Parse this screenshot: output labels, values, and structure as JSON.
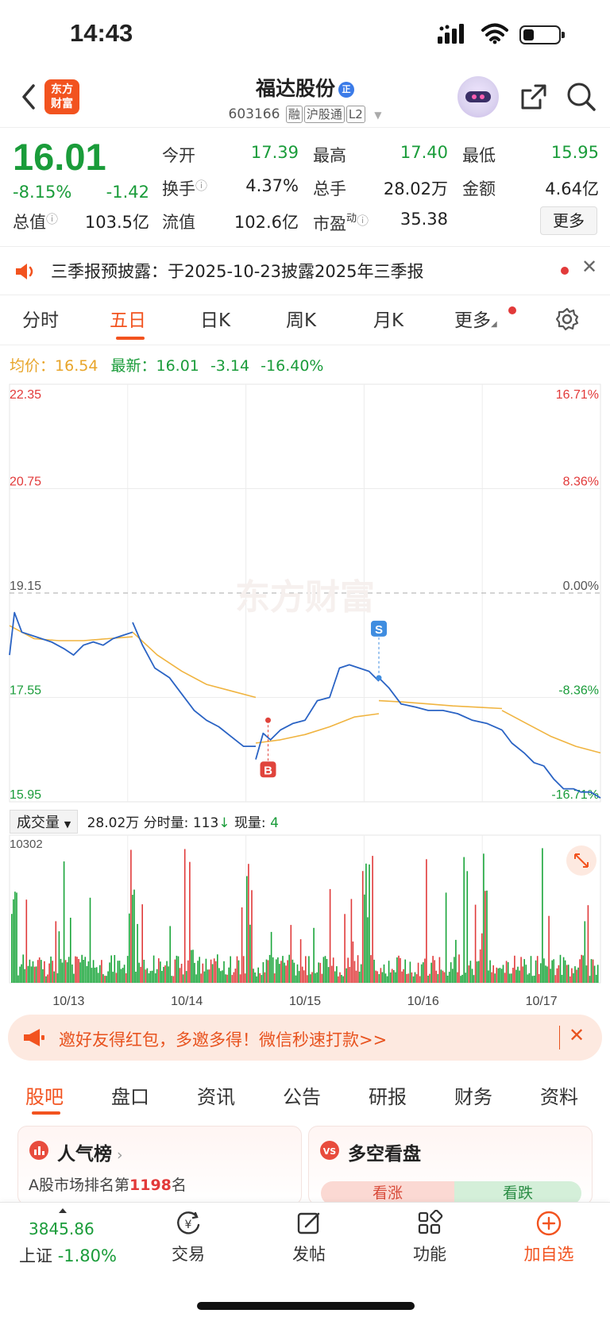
{
  "status_bar": {
    "time": "14:43"
  },
  "header": {
    "logo_line1": "东方",
    "logo_line2": "财富",
    "title": "福达股份",
    "badge": "正",
    "code": "603166",
    "tags": [
      "融",
      "沪股通",
      "L2"
    ]
  },
  "quote": {
    "price": "16.01",
    "change_pct": "-8.15%",
    "change": "-1.42",
    "fields": [
      {
        "label": "今开",
        "value": "17.39",
        "color": "#1a9c3a"
      },
      {
        "label": "最高",
        "value": "17.40",
        "color": "#1a9c3a"
      },
      {
        "label": "最低",
        "value": "15.95",
        "color": "#1a9c3a"
      },
      {
        "label": "换手",
        "value": "4.37%",
        "color": "#222222"
      },
      {
        "label": "总手",
        "value": "28.02万",
        "color": "#222222"
      },
      {
        "label": "金额",
        "value": "4.64亿",
        "color": "#222222"
      },
      {
        "label": "总值",
        "value": "103.5亿",
        "color": "#222222"
      },
      {
        "label": "流值",
        "value": "102.6亿",
        "color": "#222222"
      },
      {
        "label": "市盈",
        "value": "35.38",
        "color": "#222222"
      }
    ],
    "pe_sup": "动",
    "more_button": "更多"
  },
  "notice": {
    "text": "三季报预披露：于2025-10-23披露2025年三季报"
  },
  "chart_tabs": [
    "分时",
    "五日",
    "日K",
    "周K",
    "月K",
    "更多"
  ],
  "chart_info": {
    "avg_label": "均价：",
    "avg_value": "16.54",
    "latest_label": "最新：",
    "latest_value": "16.01",
    "latest_change": "-3.14",
    "latest_pct": "-16.40%"
  },
  "watermark": "东方财富",
  "chart_data": {
    "type": "line",
    "title": "",
    "x": [
      "10/13",
      "10/14",
      "10/15",
      "10/16",
      "10/17"
    ],
    "y_left_ticks": [
      "22.35",
      "20.75",
      "19.15",
      "17.55",
      "15.95"
    ],
    "y_right_ticks": [
      "16.71%",
      "8.36%",
      "0.00%",
      "-8.36%",
      "-16.71%"
    ],
    "ylim": [
      15.95,
      22.35
    ],
    "reference": 19.15,
    "series": [],
    "price_path": [
      [
        0.0,
        18.2
      ],
      [
        0.2,
        18.85
      ],
      [
        0.5,
        18.55
      ],
      [
        0.9,
        18.5
      ],
      [
        1.3,
        18.45
      ],
      [
        1.7,
        18.4
      ],
      [
        2.2,
        18.3
      ],
      [
        2.6,
        18.2
      ],
      [
        3.0,
        18.35
      ],
      [
        3.4,
        18.4
      ],
      [
        3.8,
        18.35
      ],
      [
        4.2,
        18.45
      ],
      [
        4.6,
        18.5
      ],
      [
        5.0,
        18.55
      ],
      [
        5.0,
        18.7
      ],
      [
        5.4,
        18.35
      ],
      [
        5.9,
        18.0
      ],
      [
        6.5,
        17.85
      ],
      [
        7.0,
        17.6
      ],
      [
        7.5,
        17.35
      ],
      [
        8.0,
        17.2
      ],
      [
        8.5,
        17.1
      ],
      [
        9.0,
        16.95
      ],
      [
        9.5,
        16.8
      ],
      [
        10.0,
        16.8
      ],
      [
        10.0,
        16.6
      ],
      [
        10.3,
        17.0
      ],
      [
        10.6,
        16.9
      ],
      [
        11.0,
        17.05
      ],
      [
        11.5,
        17.15
      ],
      [
        12.0,
        17.2
      ],
      [
        12.5,
        17.5
      ],
      [
        13.0,
        17.55
      ],
      [
        13.4,
        18.0
      ],
      [
        13.8,
        18.05
      ],
      [
        14.2,
        18.0
      ],
      [
        14.6,
        17.95
      ],
      [
        15.0,
        17.8
      ],
      [
        15.0,
        17.85
      ],
      [
        15.4,
        17.7
      ],
      [
        15.9,
        17.45
      ],
      [
        16.5,
        17.4
      ],
      [
        17.0,
        17.35
      ],
      [
        17.6,
        17.35
      ],
      [
        18.2,
        17.3
      ],
      [
        18.8,
        17.2
      ],
      [
        19.4,
        17.15
      ],
      [
        20.0,
        17.05
      ],
      [
        20.0,
        17.05
      ],
      [
        20.4,
        16.85
      ],
      [
        20.9,
        16.7
      ],
      [
        21.3,
        16.55
      ],
      [
        21.7,
        16.5
      ],
      [
        22.1,
        16.3
      ],
      [
        22.5,
        16.15
      ],
      [
        22.9,
        16.15
      ],
      [
        23.2,
        16.1
      ],
      [
        23.6,
        16.1
      ],
      [
        24.0,
        16.01
      ]
    ],
    "avg_path": [
      [
        0.0,
        18.65
      ],
      [
        0.5,
        18.55
      ],
      [
        1.0,
        18.45
      ],
      [
        2.0,
        18.42
      ],
      [
        3.0,
        18.42
      ],
      [
        4.0,
        18.45
      ],
      [
        5.0,
        18.48
      ],
      [
        5.0,
        18.55
      ],
      [
        6.0,
        18.2
      ],
      [
        7.0,
        17.95
      ],
      [
        8.0,
        17.75
      ],
      [
        9.0,
        17.65
      ],
      [
        10.0,
        17.55
      ],
      [
        10.0,
        16.85
      ],
      [
        11.0,
        16.9
      ],
      [
        12.0,
        16.98
      ],
      [
        13.0,
        17.1
      ],
      [
        14.0,
        17.25
      ],
      [
        15.0,
        17.3
      ],
      [
        15.0,
        17.5
      ],
      [
        16.0,
        17.48
      ],
      [
        17.0,
        17.45
      ],
      [
        18.0,
        17.42
      ],
      [
        19.0,
        17.4
      ],
      [
        20.0,
        17.38
      ],
      [
        20.0,
        17.35
      ],
      [
        21.0,
        17.15
      ],
      [
        22.0,
        16.95
      ],
      [
        23.0,
        16.8
      ],
      [
        24.0,
        16.7
      ]
    ],
    "markers": [
      {
        "label": "B",
        "x": 10.5,
        "price": 17.2,
        "color": "#e0443c"
      },
      {
        "label": "S",
        "x": 15.0,
        "price": 17.85,
        "color": "#3f8de0"
      }
    ]
  },
  "volume_bar": {
    "selector": "成交量",
    "total": "28.02万",
    "minute_label": "分时量:",
    "minute_value": "113",
    "now_label": "现量:",
    "now_value": "4",
    "max_label": "10302"
  },
  "invite": {
    "text": "邀好友得红包，多邀多得！微信秒速打款>>"
  },
  "bottom_tabs": [
    "股吧",
    "盘口",
    "资讯",
    "公告",
    "研报",
    "财务",
    "资料"
  ],
  "cards": {
    "rank_title": "人气榜",
    "rank_sub_prefix": "A股市场排名第",
    "rank_value": "1198",
    "rank_sub_suffix": "名",
    "ls_title": "多空看盘",
    "bull": "看涨",
    "bear": "看跌"
  },
  "bottom_bar": {
    "index_value": "3845.86",
    "index_name": "上证",
    "index_change": "-1.80%",
    "nav": [
      "交易",
      "发帖",
      "功能",
      "加自选"
    ]
  }
}
